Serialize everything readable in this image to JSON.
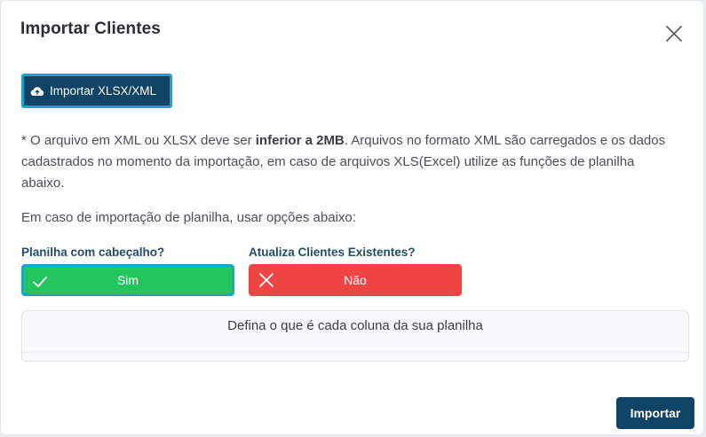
{
  "modal": {
    "title": "Importar Clientes",
    "close_icon": "close-icon"
  },
  "import_file_button": {
    "label": "Importar XLSX/XML",
    "icon": "cloud-upload-icon"
  },
  "info": {
    "p1_prefix": "* O arquivo em XML ou XLSX deve ser ",
    "p1_bold": "inferior a 2MB",
    "p1_suffix": ". Arquivos no formato XML são carregados e os dados cadastrados no momento da importação, em caso de arquivos XLS(Excel) utilize as funções de planilha abaixo.",
    "p2": "Em caso de importação de planilha, usar opções abaixo:"
  },
  "options": {
    "header": {
      "label": "Planilha com cabeçalho?",
      "value": "Sim",
      "icon": "check-icon",
      "color": "#22c55e"
    },
    "update_existing": {
      "label": "Atualiza Clientes Existentes?",
      "value": "Não",
      "icon": "x-icon",
      "color": "#ef4444"
    }
  },
  "columns_panel": {
    "title": "Defina o que é cada coluna da sua planilha"
  },
  "footer": {
    "submit_label": "Importar"
  },
  "colors": {
    "primary": "#0f4466",
    "focus_ring": "#19a7c6"
  }
}
